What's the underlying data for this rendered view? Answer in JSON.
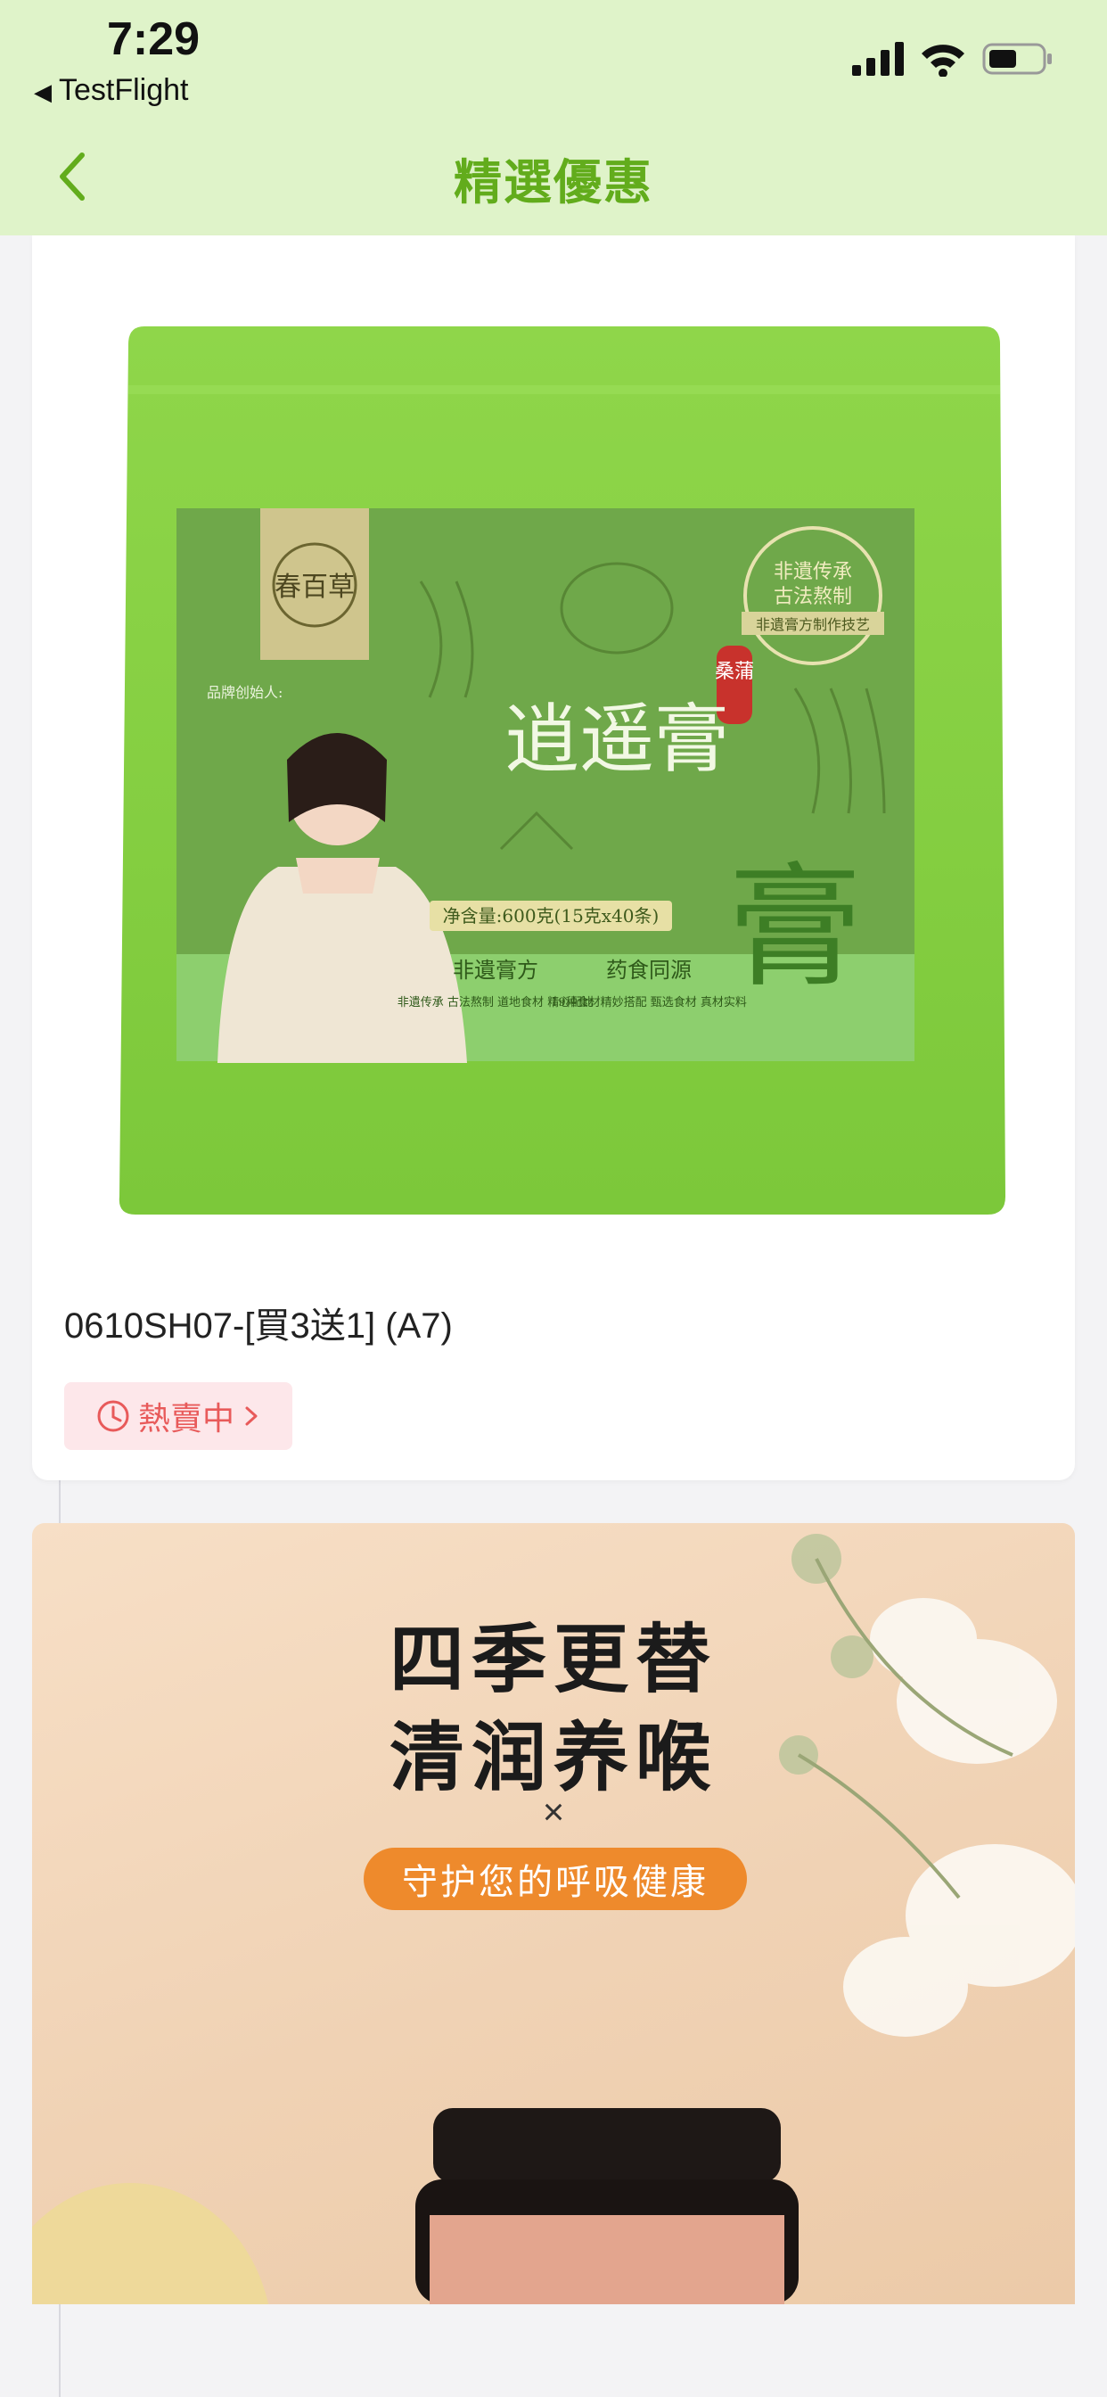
{
  "status_bar": {
    "time": "7:29",
    "back_app": "TestFlight",
    "icons": [
      "signal-icon",
      "wifi-icon",
      "battery-icon"
    ]
  },
  "nav": {
    "title": "精選優惠",
    "back_icon": "chevron-left-icon"
  },
  "product": {
    "name": "0610SH07-[買3送1] (A7)",
    "status_badge": "熱賣中",
    "badge_icon": "clock-icon",
    "badge_arrow_icon": "chevron-right-icon",
    "image": {
      "brand_logo_text": "春百草",
      "stamp_line1": "非遺传承",
      "stamp_line2": "古法熬制",
      "stamp_line3": "非遺膏方制作技艺",
      "product_tag": "桑蒲",
      "product_title": "逍遥膏",
      "net_content": "净含量:600克(15克x40条)",
      "feature_1_title": "非遺膏方",
      "feature_1_desc": "非遺传承 古法熬制 道地食材 精心配比",
      "feature_2_title": "药食同源",
      "feature_2_desc": "19种食材精妙搭配 甄选食材 真材实料",
      "founder_label": "品牌创始人:"
    }
  },
  "banner": {
    "line1": "四季更替",
    "line2": "清润养喉",
    "separator": "×",
    "pill_text": "守护您的呼吸健康"
  },
  "colors": {
    "header_bg": "#dff3c9",
    "accent_green": "#62ac1c",
    "badge_red": "#e85a5a",
    "badge_bg": "#fde7ea",
    "pill_orange": "#ee8a2c"
  }
}
